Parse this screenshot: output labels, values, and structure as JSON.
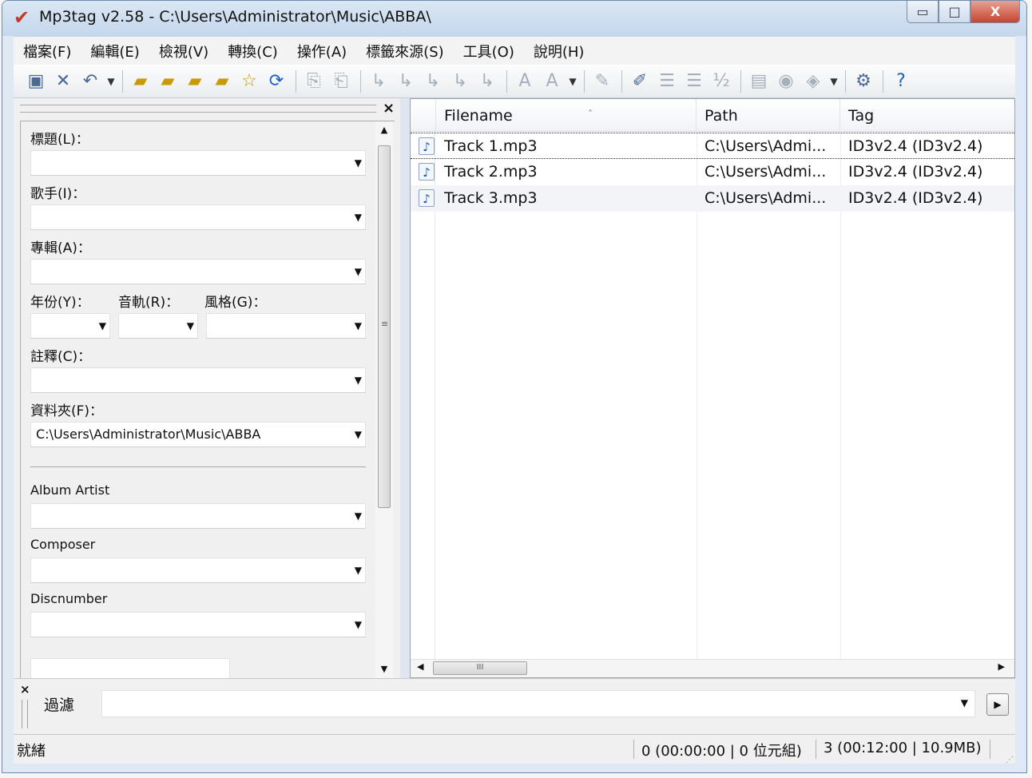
{
  "window": {
    "title": "Mp3tag v2.58  -  C:\\Users\\Administrator\\Music\\ABBA\\"
  },
  "window_controls": {
    "minimize": "▭",
    "maximize": "□",
    "close": "X"
  },
  "menu": [
    "檔案(F)",
    "編輯(E)",
    "檢視(V)",
    "轉換(C)",
    "操作(A)",
    "標籤來源(S)",
    "工具(O)",
    "說明(H)"
  ],
  "toolbar_icons": [
    "save-icon",
    "remove-tag-icon",
    "undo-icon",
    "open-folder-icon",
    "add-folder-icon",
    "playlist-icon",
    "favorite-folder-icon",
    "favorites-star-icon",
    "refresh-icon",
    "copy-tag-icon",
    "paste-tag-icon",
    "tag-filename-icon",
    "filename-tag-icon",
    "text-tag-icon",
    "tag-tag-icon",
    "filename-filename-icon",
    "actions-icon",
    "actions-quick-icon",
    "autonumber-wizard-icon",
    "export-icon",
    "playlist-create-icon",
    "tag-sources-icon",
    "freedb-icon",
    "amazon-icon",
    "musicbrainz-icon",
    "discogs-icon",
    "options-icon",
    "help-icon"
  ],
  "tagpanel": {
    "title_label": "標題(L)：",
    "artist_label": "歌手(I)：",
    "album_label": "專輯(A)：",
    "year_label": "年份(Y)：",
    "track_label": "音軌(R)：",
    "genre_label": "風格(G)：",
    "comment_label": "註釋(C)：",
    "folder_label": "資料夾(F)：",
    "folder_value": "C:\\Users\\Administrator\\Music\\ABBA",
    "album_artist_label": "Album Artist",
    "composer_label": "Composer",
    "discnumber_label": "Discnumber"
  },
  "filelist": {
    "columns": [
      "Filename",
      "Path",
      "Tag"
    ],
    "sort_indicator": "ˆ",
    "rows": [
      {
        "filename": "Track 1.mp3",
        "path": "C:\\Users\\Admi...",
        "tag": "ID3v2.4 (ID3v2.4)"
      },
      {
        "filename": "Track 2.mp3",
        "path": "C:\\Users\\Admi...",
        "tag": "ID3v2.4 (ID3v2.4)"
      },
      {
        "filename": "Track 3.mp3",
        "path": "C:\\Users\\Admi...",
        "tag": "ID3v2.4 (ID3v2.4)"
      }
    ]
  },
  "filter": {
    "close": "×",
    "label": "過濾",
    "value": ""
  },
  "status": {
    "text": "就緒",
    "selection": "0 (00:00:00 | 0 位元組)",
    "total": "3 (00:12:00 | 10.9MB)"
  }
}
